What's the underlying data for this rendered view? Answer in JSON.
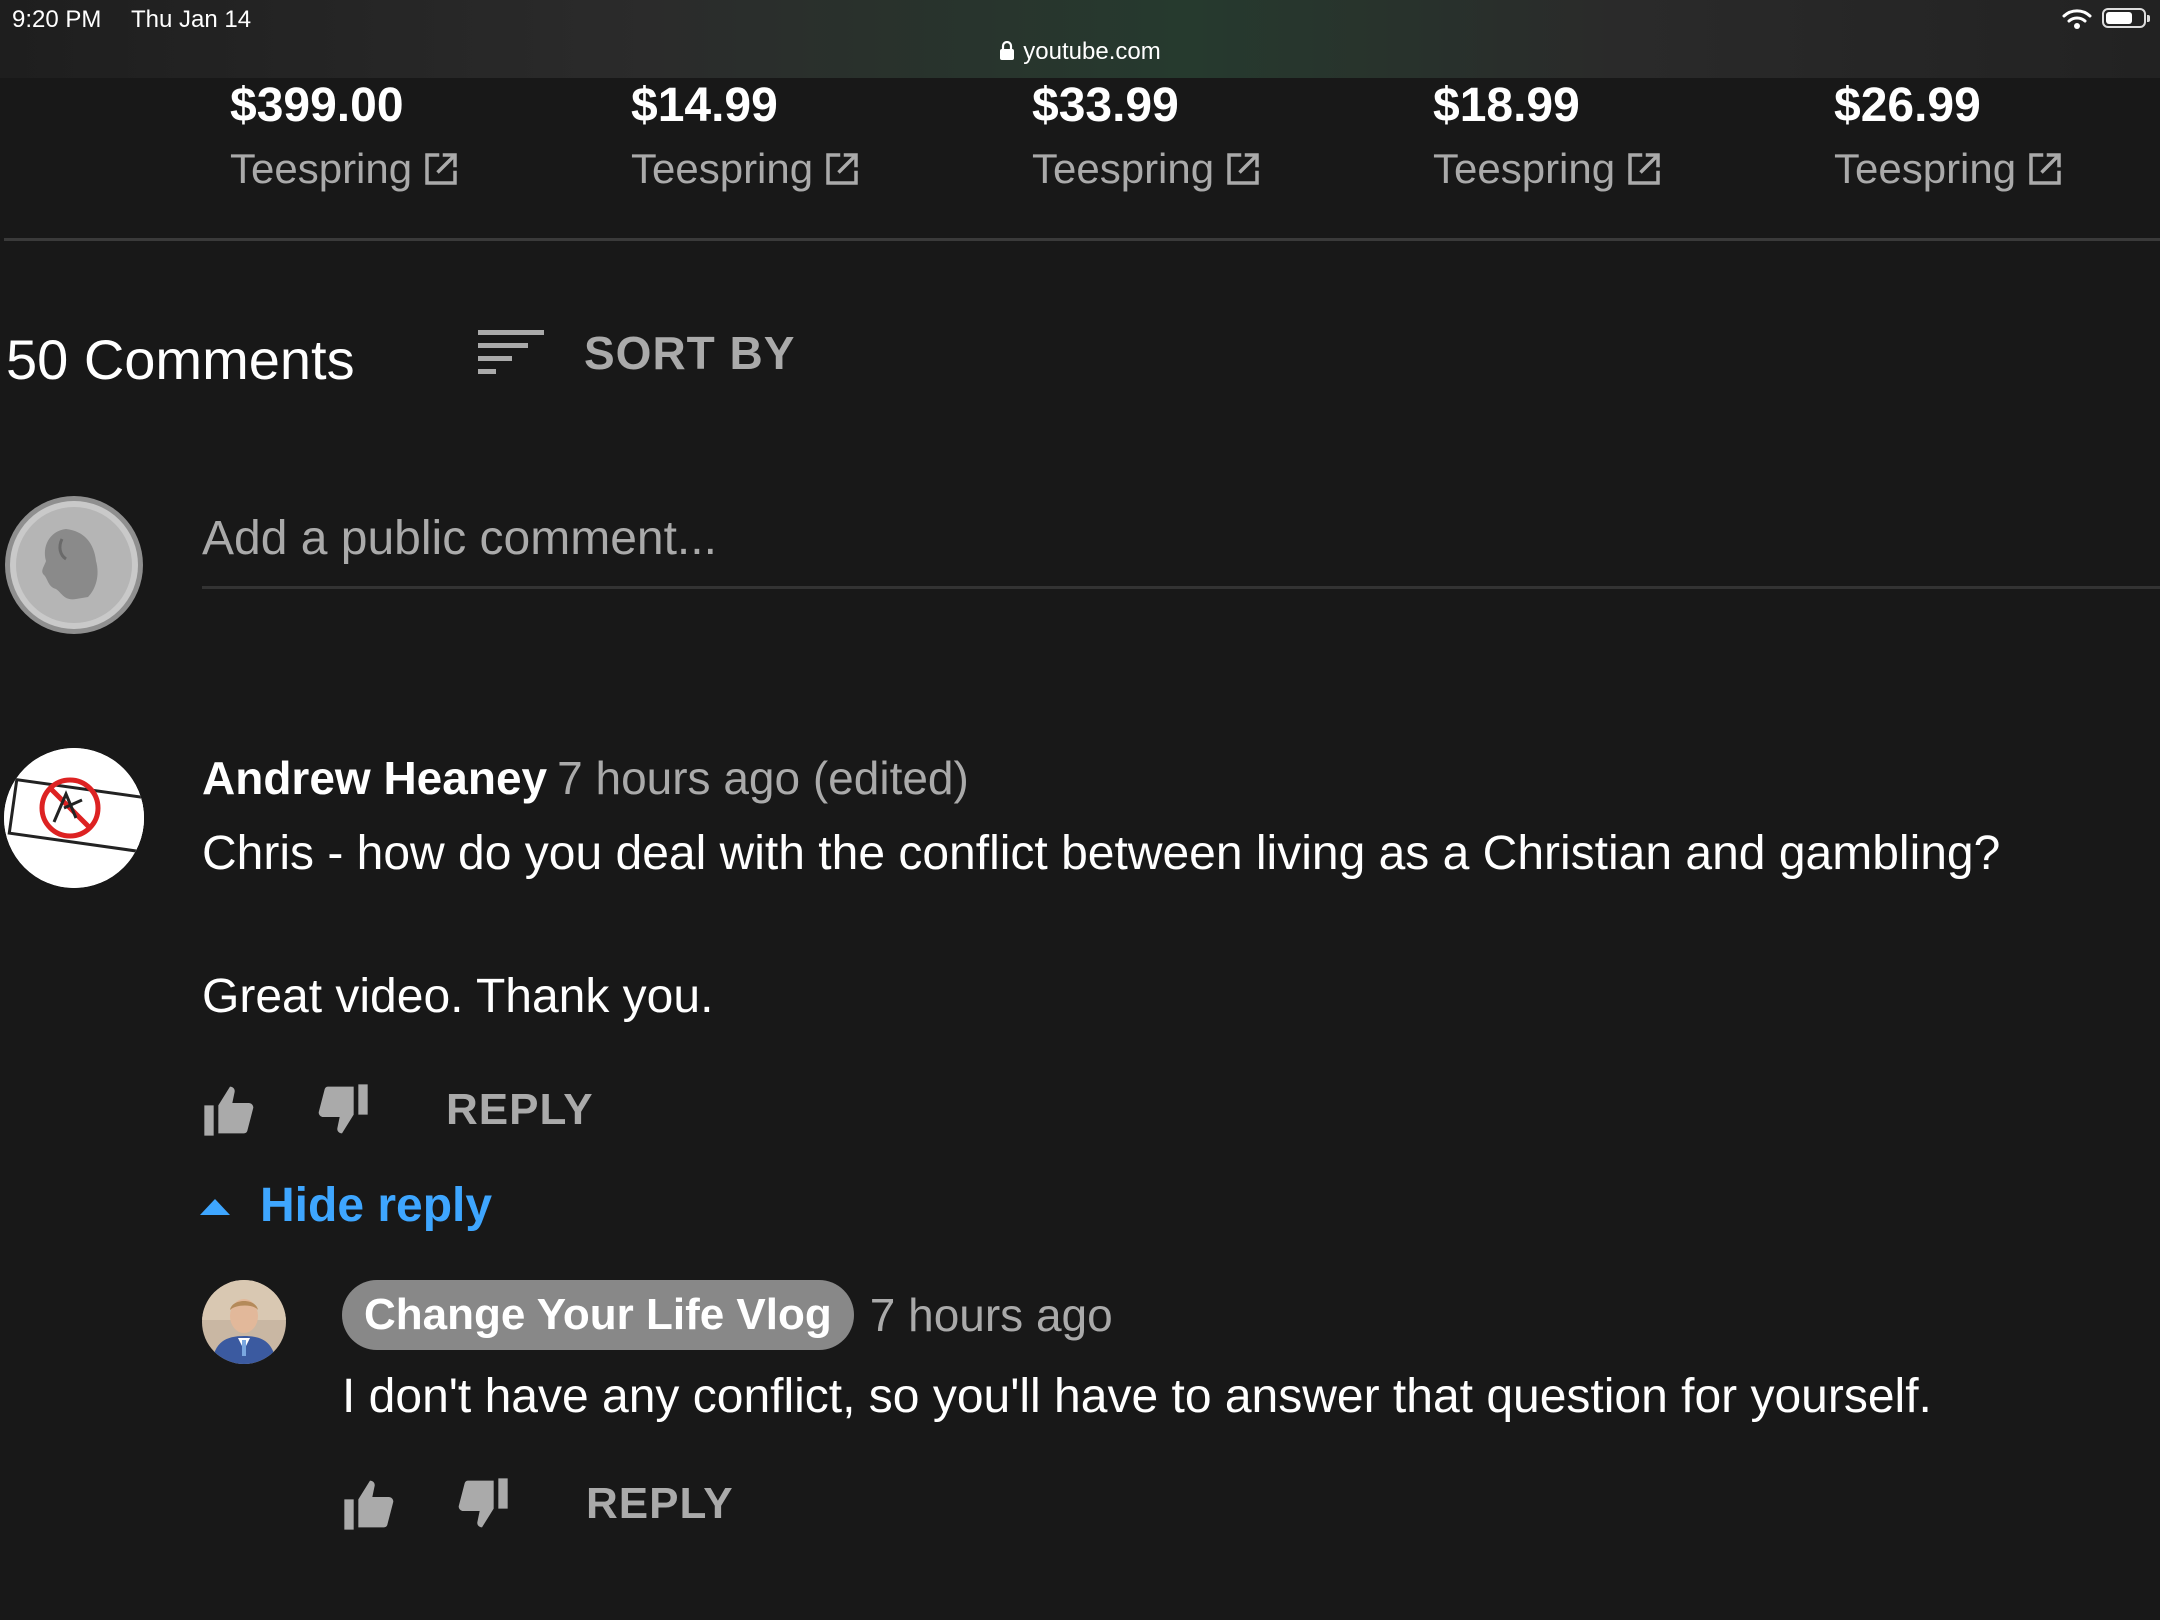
{
  "status_bar": {
    "time": "9:20 PM",
    "date": "Thu Jan 14",
    "url": "youtube.com"
  },
  "merch": [
    {
      "price": "$399.00",
      "vendor": "Teespring"
    },
    {
      "price": "$14.99",
      "vendor": "Teespring"
    },
    {
      "price": "$33.99",
      "vendor": "Teespring"
    },
    {
      "price": "$18.99",
      "vendor": "Teespring"
    },
    {
      "price": "$26.99",
      "vendor": "Teespring"
    }
  ],
  "comments": {
    "count_label": "50 Comments",
    "sort_label": "SORT BY",
    "add_placeholder": "Add a public comment...",
    "items": [
      {
        "author": "Andrew Heaney",
        "meta": "7 hours ago (edited)",
        "line1": "Chris - how do you deal with the conflict between living as a Christian and gambling?",
        "line2": "Great video. Thank you.",
        "reply_label": "REPLY",
        "hide_replies_label": "Hide reply",
        "replies": [
          {
            "author": "Change Your Life Vlog",
            "meta": "7 hours ago",
            "text": "I don't have any conflict, so you'll have to answer that question for yourself.",
            "reply_label": "REPLY"
          }
        ]
      }
    ]
  },
  "colors": {
    "background": "#181818",
    "link_blue": "#3ea6ff",
    "secondary_text": "#aaaaaa"
  }
}
